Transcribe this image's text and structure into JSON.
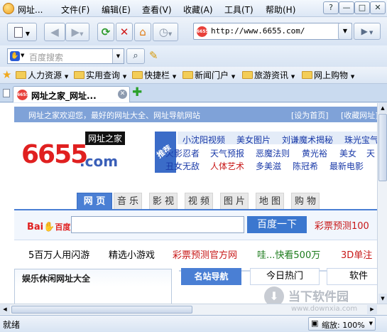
{
  "window": {
    "title": "网址...",
    "menu": [
      "文件(F)",
      "编辑(E)",
      "查看(V)",
      "收藏(A)",
      "工具(T)",
      "帮助(H)"
    ],
    "controls": [
      "?",
      "—",
      "□",
      "✕"
    ]
  },
  "toolbar": {
    "address": "http://www.6655.com/"
  },
  "search": {
    "placeholder": "百度搜索"
  },
  "favorites": [
    "人力资源",
    "实用查询",
    "快捷栏",
    "新闻门户",
    "旅游资讯",
    "网上购物"
  ],
  "tabs": [
    {
      "title": "网址之家_网址..."
    }
  ],
  "page": {
    "welcome": "网址之家欢迎您，最好的网址大全、网址导航网站",
    "set_home": "[设为首页]",
    "add_fav": "[收藏网址]",
    "logo_number": "6655",
    "logo_domain": ".com",
    "logo_badge": "网址之家",
    "recommend_label": "推荐",
    "recommend": [
      [
        "小沈阳视频",
        "美女图片",
        "刘谦魔术揭秘",
        "珠光宝气"
      ],
      [
        "火影忍者",
        "天气预报",
        "恶魔法则",
        "黄光裕",
        "美女",
        "天"
      ],
      [
        "丑女无敌",
        "人体艺术",
        "多美滋",
        "陈冠希",
        "最新电影"
      ]
    ],
    "search_tabs": [
      "网 页",
      "音 乐",
      "影 视",
      "视 频",
      "图 片",
      "地 图",
      "购 物"
    ],
    "baidu_logo_a": "Bai",
    "baidu_logo_b": "百度",
    "baidu_button": "百度一下",
    "lottery": "彩票预测100",
    "promo": [
      "5百万人用闪游",
      "精选小游戏",
      "彩票预测官方网",
      "哇...快看500万",
      "3D单注"
    ],
    "section_title": "娱乐休闲网址大全",
    "section_tabs": [
      "名站导航",
      "今日热门",
      "软件"
    ]
  },
  "status": {
    "text": "就绪",
    "zoom": "缩放: 100%"
  },
  "watermark": {
    "name": "当下软件园",
    "url": "www.downxia.com"
  },
  "colors": {
    "accent_blue": "#1a3aa8",
    "red": "#c81818",
    "welcome_bar": "#7fa2d8",
    "baidu_button": "#3b77cf"
  }
}
